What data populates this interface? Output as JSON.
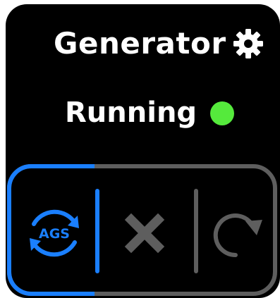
{
  "header": {
    "title": "Generator",
    "settings_icon": "gear-icon"
  },
  "status": {
    "text": "Running",
    "indicator_color": "#55ea3c"
  },
  "controls": {
    "active_mode": "AGS",
    "buttons": [
      {
        "label": "AGS",
        "icon": "ags-cycle-icon",
        "active": true
      },
      {
        "label": "",
        "icon": "stop-x-icon",
        "active": false
      },
      {
        "label": "",
        "icon": "restart-icon",
        "active": false
      }
    ]
  },
  "colors": {
    "active": "#1a7fff",
    "inactive": "#5e5e5e",
    "running": "#55ea3c",
    "background": "#000000"
  }
}
